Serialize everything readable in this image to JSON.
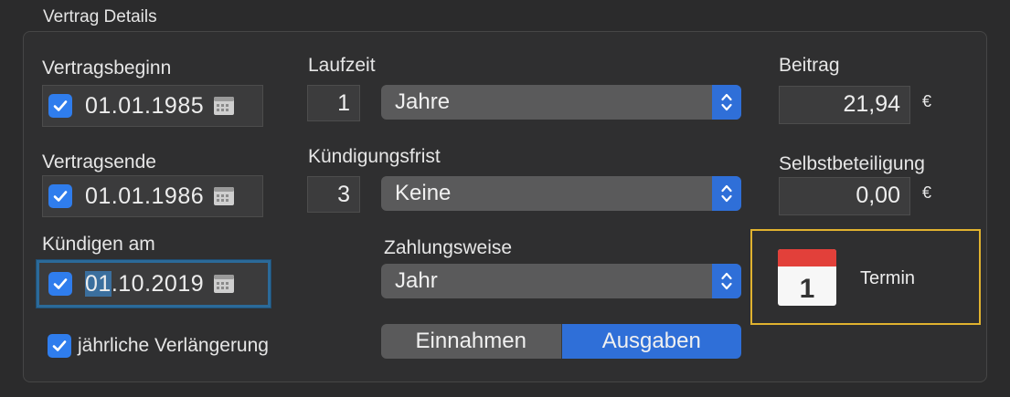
{
  "group_title": "Vertrag Details",
  "vertragsbeginn": {
    "label": "Vertragsbeginn",
    "date": "01.01.1985",
    "checked": true
  },
  "vertragsende": {
    "label": "Vertragsende",
    "date": "01.01.1986",
    "checked": true
  },
  "kuendigen_am": {
    "label": "Kündigen am",
    "date_selected": "01",
    "date_rest": ".10.2019",
    "checked": true
  },
  "laufzeit": {
    "label": "Laufzeit",
    "number": "1",
    "unit": "Jahre"
  },
  "kuendigungsfrist": {
    "label": "Kündigungsfrist",
    "number": "3",
    "unit": "Keine"
  },
  "zahlungsweise": {
    "label": "Zahlungsweise",
    "value": "Jahr"
  },
  "beitrag": {
    "label": "Beitrag",
    "value": "21,94",
    "currency": "€"
  },
  "selbstbeteiligung": {
    "label": "Selbstbeteiligung",
    "value": "0,00",
    "currency": "€"
  },
  "segment": {
    "options": [
      "Einnahmen",
      "Ausgaben"
    ],
    "selected": "Ausgaben"
  },
  "termin": {
    "label": "Termin",
    "icon_day": "1"
  },
  "renewal": {
    "label": "jährliche Verlängerung",
    "checked": true
  },
  "colors": {
    "accent": "#2f6fd8",
    "checkbox": "#2f7ded",
    "focus_ring": "#2b6a99",
    "highlight_border": "#e0b22f"
  }
}
